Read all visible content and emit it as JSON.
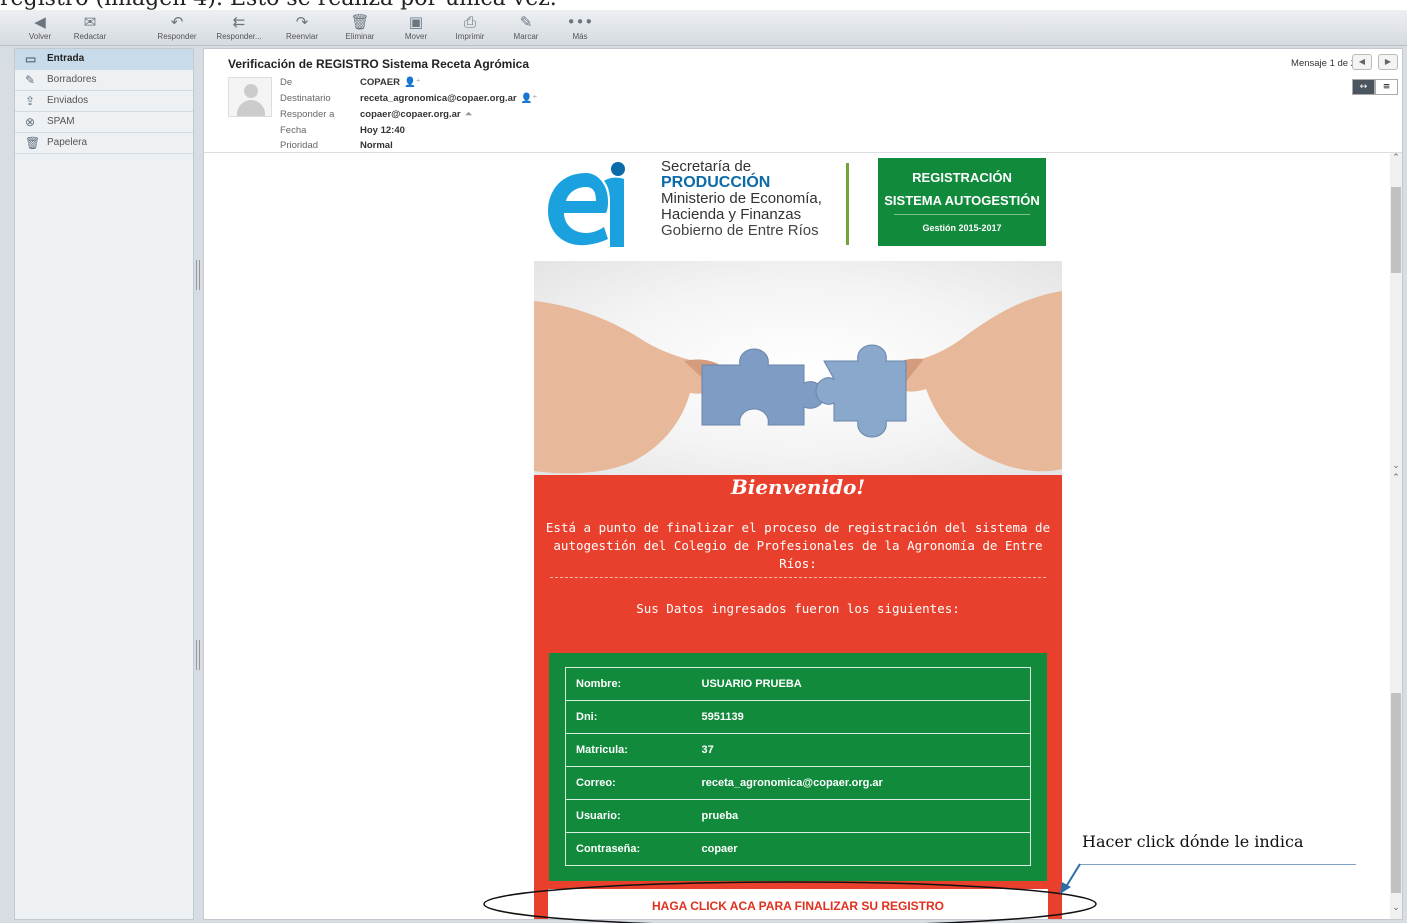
{
  "caption": "registro (imagen 4). Esto se realiza por única vez.",
  "toolbar": {
    "buttons": [
      {
        "label": "Volver",
        "icon": "arrow-left-icon"
      },
      {
        "label": "Redactar",
        "icon": "compose-icon"
      },
      {
        "label": "Responder",
        "icon": "reply-icon"
      },
      {
        "label": "Responder...",
        "icon": "reply-all-icon"
      },
      {
        "label": "Reenviar",
        "icon": "forward-icon"
      },
      {
        "label": "Eliminar",
        "icon": "trash-icon"
      },
      {
        "label": "Mover",
        "icon": "move-icon"
      },
      {
        "label": "Imprimir",
        "icon": "print-icon"
      },
      {
        "label": "Marcar",
        "icon": "mark-icon"
      },
      {
        "label": "Más",
        "icon": "more-icon"
      }
    ]
  },
  "folders": [
    {
      "label": "Entrada",
      "icon": "inbox-icon",
      "active": true
    },
    {
      "label": "Borradores",
      "icon": "pencil-icon"
    },
    {
      "label": "Enviados",
      "icon": "sent-icon"
    },
    {
      "label": "SPAM",
      "icon": "spam-icon"
    },
    {
      "label": "Papelera",
      "icon": "trash-icon"
    }
  ],
  "message": {
    "subject": "Verificación de REGISTRO Sistema Receta Agrómica",
    "counter": "Mensaje 1 de 2",
    "fields": [
      {
        "key": "De",
        "value": "COPAER"
      },
      {
        "key": "Destinatario",
        "value": "receta_agronomica@copaer.org.ar"
      },
      {
        "key": "Responder a",
        "value": "copaer@copaer.org.ar"
      },
      {
        "key": "Fecha",
        "value": "Hoy 12:40"
      },
      {
        "key": "Prioridad",
        "value": "Normal"
      }
    ]
  },
  "email": {
    "brand": {
      "line1": "Secretaría de",
      "line2": "PRODUCCIÓN",
      "line3": "Ministerio de Economía,",
      "line4": "Hacienda y Finanzas",
      "line5": "Gobierno de Entre Ríos"
    },
    "reg_box": {
      "line1": "REGISTRACIÓN",
      "line2": "SISTEMA AUTOGESTIÓN",
      "line3": "Gestión 2015-2017"
    },
    "welcome": "Bienvenido!",
    "intro": "Está a punto de finalizar el proceso de registración del sistema de autogestión del Colegio de Profesionales de la Agronomía de Entre Ríos:",
    "datos_heading": "Sus Datos ingresados fueron los siguientes:",
    "rows": [
      {
        "key": "Nombre:",
        "value": "USUARIO PRUEBA"
      },
      {
        "key": "Dni:",
        "value": "5951139"
      },
      {
        "key": "Matricula:",
        "value": "37"
      },
      {
        "key": "Correo:",
        "value": "receta_agronomica@copaer.org.ar"
      },
      {
        "key": "Usuario:",
        "value": "prueba"
      },
      {
        "key": "Contraseña:",
        "value": "copaer"
      }
    ],
    "cta": "HAGA CLICK ACA PARA FINALIZAR SU REGISTRO"
  },
  "annotation": "Hacer click dónde le indica",
  "colors": {
    "red": "#e8402c",
    "green": "#118a3c",
    "blue": "#0b6aa8"
  }
}
